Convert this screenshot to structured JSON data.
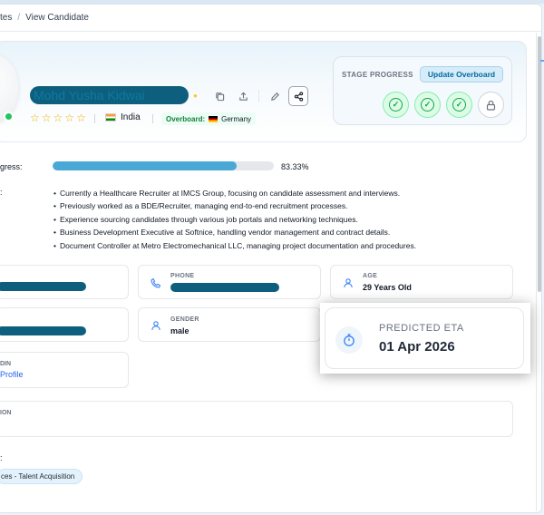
{
  "breadcrumb": {
    "parent": "tes",
    "separator": "/",
    "current": "View Candidate"
  },
  "candidate": {
    "name": "Mohd Yusha Kidwai",
    "star_count": 5,
    "country": "India",
    "overboard_label": "Overboard:",
    "overboard_country": "Germany"
  },
  "stage": {
    "label": "STAGE PROGRESS",
    "update_button": "Update Overboard",
    "steps": [
      {
        "state": "completed",
        "icon": "check-icon"
      },
      {
        "state": "completed",
        "icon": "check-icon"
      },
      {
        "state": "completed",
        "icon": "check-icon"
      },
      {
        "state": "locked",
        "icon": "lock-icon"
      }
    ]
  },
  "progress": {
    "label": "gress:",
    "value_text": "83.33%",
    "fraction": 0.8333
  },
  "summary": {
    "label": ":",
    "items": [
      "Currently a Healthcare Recruiter at IMCS Group, focusing on candidate assessment and interviews.",
      "Previously worked as a BDE/Recruiter, managing end-to-end recruitment processes.",
      "Experience sourcing candidates through various job portals and networking techniques.",
      "Business Development Executive at Softnice, handling vendor management and contract details.",
      "Document Controller at Metro Electromechanical LLC, managing project documentation and procedures."
    ]
  },
  "details": {
    "phone_label": "PHONE",
    "age_label": "AGE",
    "age_value": "29 Years Old",
    "gender_label": "GENDER",
    "gender_value": "male",
    "eta_label": "PREDICTED ETA",
    "eta_value": "01 Apr 2026",
    "linkedin_label": "DIN",
    "linkedin_link": "Profile",
    "location_label": "ION",
    "skills_label": ":",
    "skill_tag": "ces - Talent Acquisition"
  },
  "colors": {
    "accent": "#4aa8d6",
    "success": "#16a34a",
    "brand": "#0e5f7d",
    "link": "#2563eb"
  }
}
